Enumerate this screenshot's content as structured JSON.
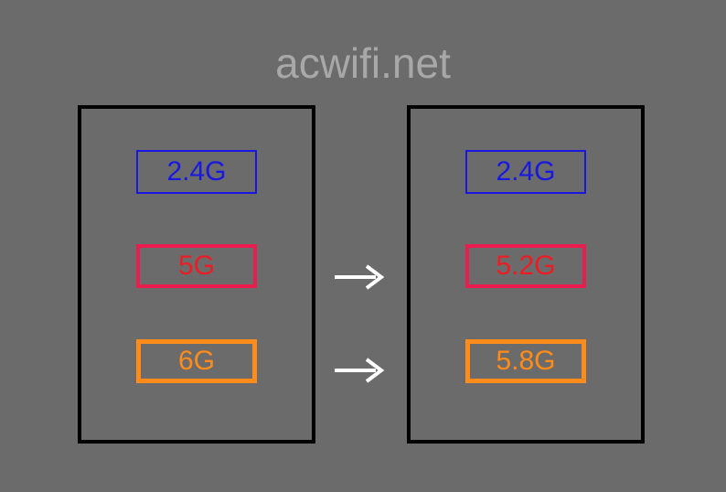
{
  "title": "acwifi.net",
  "left_panel": {
    "bands": [
      {
        "label": "2.4G",
        "color": "#1818e0"
      },
      {
        "label": "5G",
        "color": "#ed1c24"
      },
      {
        "label": "6G",
        "color": "#ff8c1a"
      }
    ]
  },
  "right_panel": {
    "bands": [
      {
        "label": "2.4G",
        "color": "#1818e0"
      },
      {
        "label": "5.2G",
        "color": "#ed1c24"
      },
      {
        "label": "5.8G",
        "color": "#ff8c1a"
      }
    ]
  },
  "arrows": {
    "count": 2,
    "stroke": "#ffffff"
  }
}
